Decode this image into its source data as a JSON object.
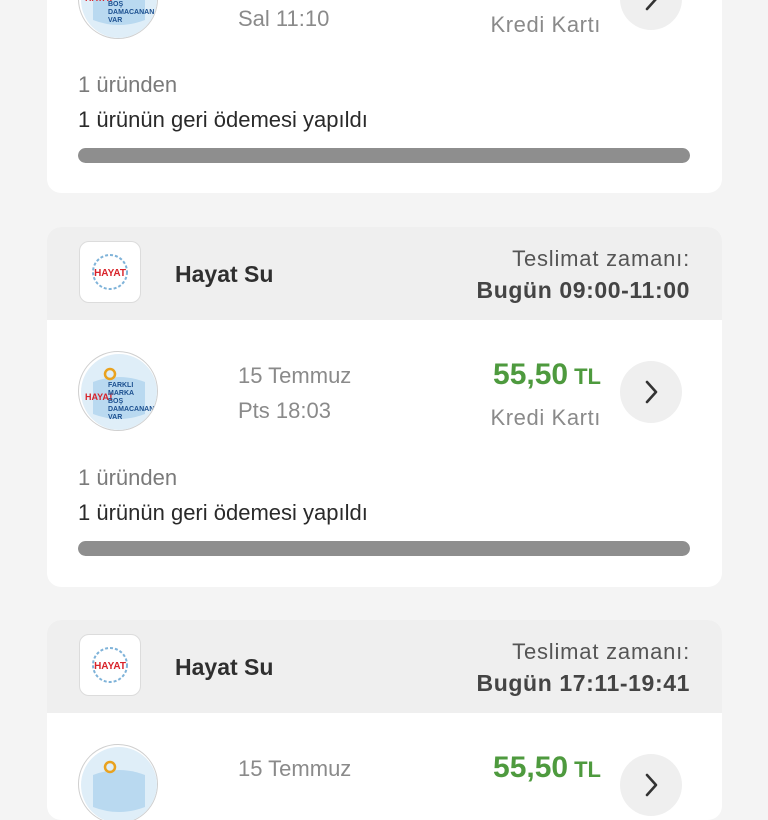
{
  "orders": [
    {
      "date_line1": "",
      "date_line2": "Sal 11:10",
      "price_amount": "",
      "price_currency": "",
      "payment_method": "Kredi Kartı",
      "item_count_text": "1 üründen",
      "refund_text": "1 ürünün geri ödemesi yapıldı",
      "refund_progress": 1.0
    },
    {
      "store_name": "Hayat Su",
      "delivery_label": "Teslimat zamanı:",
      "delivery_time": "Bugün 09:00-11:00",
      "date_line1": "15 Temmuz",
      "date_line2": "Pts 18:03",
      "price_amount": "55,50",
      "price_currency": "TL",
      "payment_method": "Kredi Kartı",
      "item_count_text": "1 üründen",
      "refund_text": "1 ürünün geri ödemesi yapıldı",
      "refund_progress": 1.0
    },
    {
      "store_name": "Hayat Su",
      "delivery_label": "Teslimat zamanı:",
      "delivery_time": "Bugün 17:11-19:41",
      "date_line1": "15 Temmuz",
      "date_line2": "",
      "price_amount": "55,50",
      "price_currency": "TL"
    }
  ],
  "product_image_text": {
    "brand": "HAYAT",
    "line1": "FARKLI",
    "line2": "MARKA",
    "line3": "BOŞ",
    "line4": "DAMACANAN",
    "line5": "VAR"
  },
  "store_logo_text": "HAYAT",
  "colors": {
    "price": "#4e9a3e",
    "card_header_bg": "#efefef",
    "progress_fill": "#8e8e8e",
    "brand_red": "#d8232a"
  },
  "icons": {
    "arrow": "chevron-right-icon"
  }
}
